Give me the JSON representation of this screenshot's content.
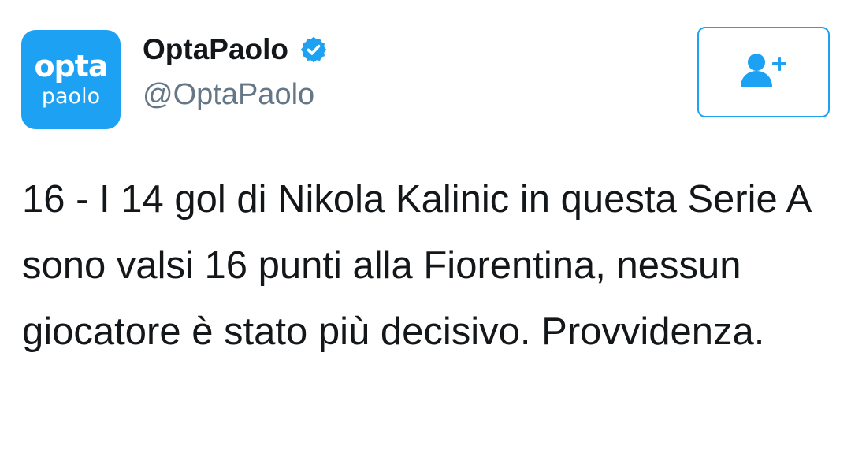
{
  "author": {
    "display_name": "OptaPaolo",
    "handle": "@OptaPaolo",
    "verified": true,
    "avatar": {
      "line1": "opta",
      "line2": "paolo",
      "color": "#1da1f2"
    }
  },
  "follow_button": {
    "icon": "add-user-icon",
    "color": "#1da1f2"
  },
  "tweet": {
    "text": "16 - I 14 gol di Nikola Kalinic in questa Serie A sono valsi 16 punti alla Fiorentina, nessun giocatore è stato più decisivo. Provvidenza."
  }
}
